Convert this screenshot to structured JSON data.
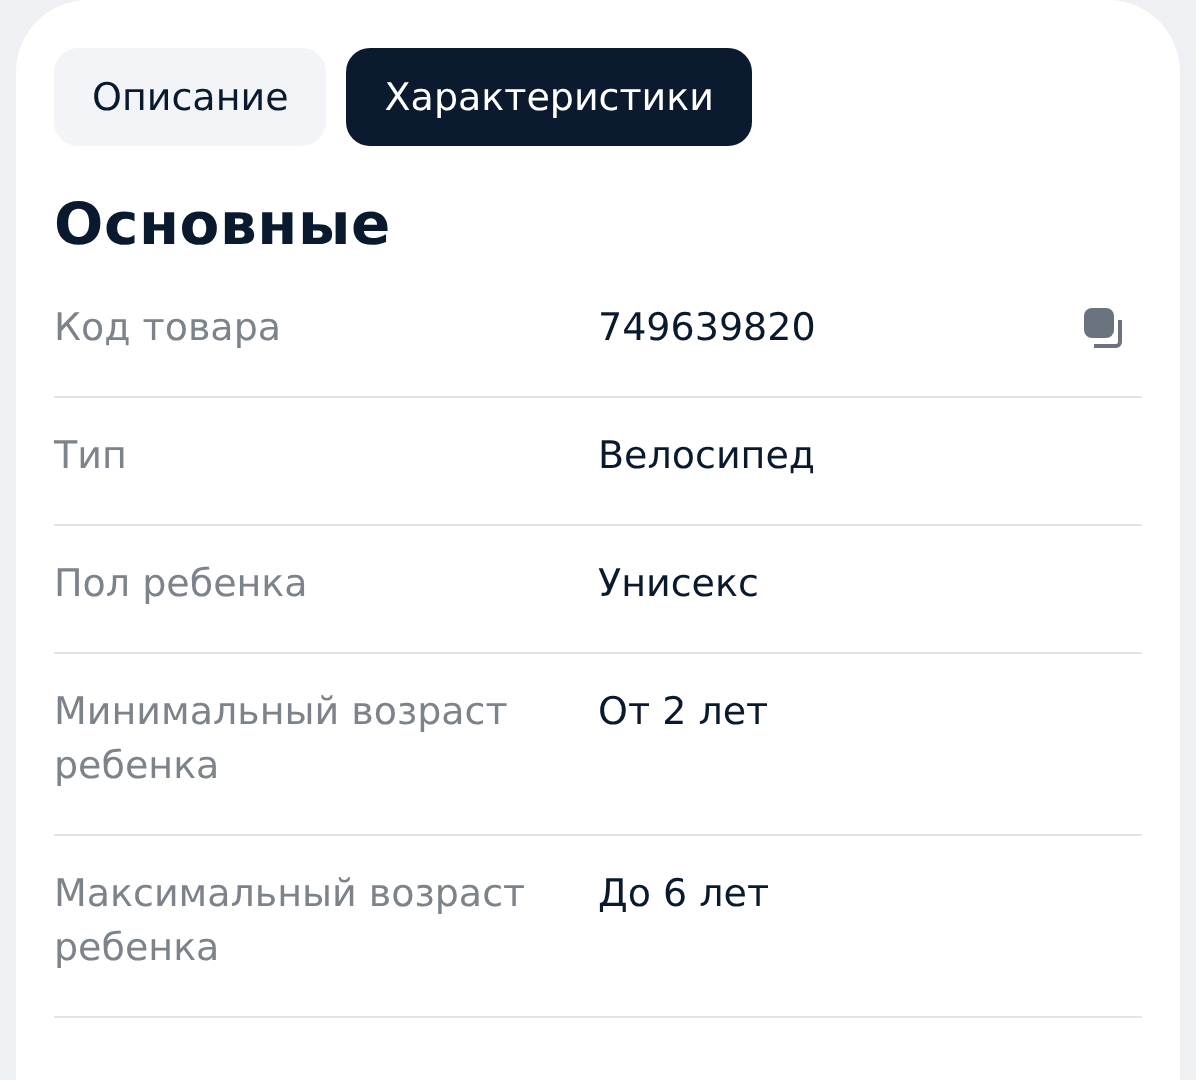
{
  "tabs": [
    {
      "label": "Описание",
      "selected": false
    },
    {
      "label": "Характеристики",
      "selected": true
    }
  ],
  "section": {
    "title": "Основные",
    "rows": [
      {
        "label": "Код товара",
        "value": "749639820",
        "copyable": true
      },
      {
        "label": "Тип",
        "value": "Велосипед",
        "copyable": false
      },
      {
        "label": "Пол ребенка",
        "value": "Унисекс",
        "copyable": false
      },
      {
        "label": "Минимальный возраст ребенка",
        "value": "От 2 лет",
        "copyable": false
      },
      {
        "label": "Максимальный возраст ребенка",
        "value": "До 6 лет",
        "copyable": false
      }
    ]
  }
}
